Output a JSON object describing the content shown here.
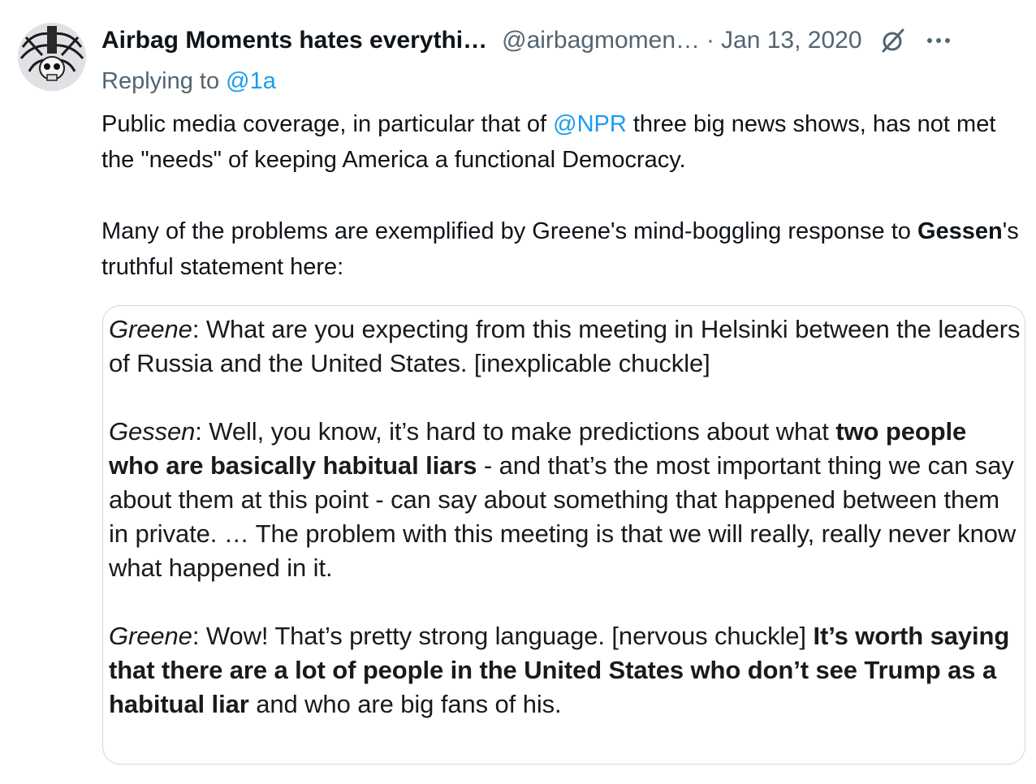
{
  "tweet": {
    "display_name": "Airbag Moments hates everythi…",
    "handle": "@airbagmomen…",
    "separator": "·",
    "date": "Jan 13, 2020",
    "icons": {
      "avatar": "skull-avatar",
      "grok": "grok-icon",
      "more": "more-icon"
    },
    "reply_prefix": "Replying to ",
    "reply_handle": "@1a",
    "text": {
      "p1_a": "Public media coverage, in particular that of ",
      "p1_mention": "@NPR",
      "p1_b": " three big news shows, has not met the \"needs\" of keeping America a functional Democracy.",
      "p2_a": "Many of the problems are exemplified by Greene's mind-boggling response to ",
      "p2_bold": "Gessen",
      "p2_b": "'s truthful statement here:"
    }
  },
  "media": {
    "q1_speaker": "Greene",
    "q1_text": ": What are you expecting from this meeting in Helsinki between the leaders of Russia and the United States. [inexplicable chuckle]",
    "q2_speaker": "Gessen",
    "q2_text_a": ": Well, you know, it’s hard to make predictions about what ",
    "q2_bold": "two people who are basically habitual liars",
    "q2_text_b": " - and that’s the most important thing we can say about them at this point - can say about something that happened between them in private. … The problem with this meeting is that we will really, really never know what happened in it.",
    "q3_speaker": "Greene",
    "q3_text_a": ": Wow! That’s pretty strong language. [nervous chuckle] ",
    "q3_bold": "It’s worth saying that there are a lot of people in the United States who don’t see Trump as a habitual liar",
    "q3_text_b": " and who are big fans of his."
  },
  "colors": {
    "link": "#1d9bf0",
    "muted": "#536471",
    "text": "#0f1419",
    "border": "#cfd9de"
  }
}
